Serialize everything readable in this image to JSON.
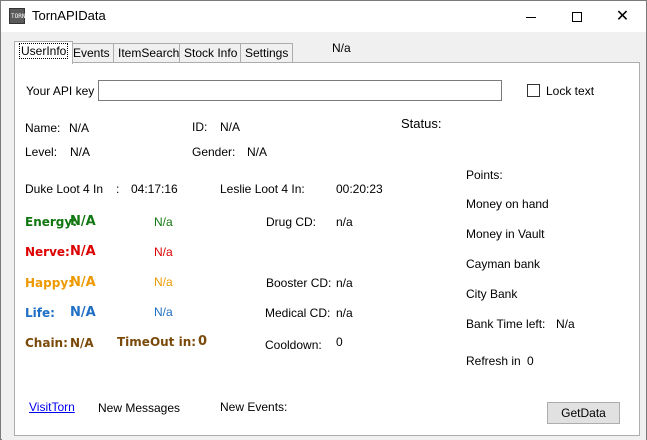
{
  "window": {
    "title": "TornAPIData",
    "icon_text": "TORN"
  },
  "colors": {
    "energy": "#117711",
    "nerve": "#dd0000",
    "happy": "#ee9900",
    "life": "#1f6fc5",
    "chain": "#7a4a0a",
    "link": "#0000ee"
  },
  "tabs": [
    "UserInfo",
    "Events",
    "ItemSearch",
    "Stock Info",
    "Settings"
  ],
  "header_status": "N/a",
  "api": {
    "label": "Your API key",
    "value": "",
    "lock_label": "Lock text",
    "lock_checked": false
  },
  "user": {
    "name_label": "Name:",
    "name": "N/A",
    "id_label": "ID:",
    "id": "N/A",
    "level_label": "Level:",
    "level": "N/A",
    "gender_label": "Gender:",
    "gender": "N/A",
    "status_label": "Status:"
  },
  "loot": {
    "duke_label": "Duke Loot 4 In",
    "duke_sep": ":",
    "duke_time": "04:17:16",
    "leslie_label": "Leslie Loot 4 In:",
    "leslie_time": "00:20:23"
  },
  "bars": {
    "energy_label": "Energy:",
    "energy_value": "N/A",
    "energy_full": "N/a",
    "nerve_label": "Nerve:",
    "nerve_value": "N/A",
    "nerve_full": "N/a",
    "happy_label": "Happy:",
    "happy_value": "N/A",
    "happy_full": "N/a",
    "life_label": "Life:",
    "life_value": "N/A",
    "life_full": "N/a",
    "chain_label": "Chain:",
    "chain_value": "N/A",
    "timeout_label": "TimeOut in:",
    "timeout_value": "0"
  },
  "cooldowns": {
    "drug_label": "Drug CD:",
    "drug_value": "n/a",
    "booster_label": "Booster CD:",
    "booster_value": "n/a",
    "medical_label": "Medical CD:",
    "medical_value": "n/a",
    "cooldown_label": "Cooldown:",
    "cooldown_value": "0"
  },
  "money": {
    "points_label": "Points:",
    "on_hand_label": "Money on hand",
    "vault_label": "Money in Vault",
    "cayman_label": "Cayman bank",
    "city_label": "City Bank",
    "bank_time_label": "Bank Time left:",
    "bank_time_value": "N/a",
    "refresh_label": "Refresh in",
    "refresh_value": "0"
  },
  "footer": {
    "visit_link": "VisitTorn",
    "messages_label": "New Messages",
    "events_label": "New Events:",
    "getdata_label": "GetData"
  }
}
